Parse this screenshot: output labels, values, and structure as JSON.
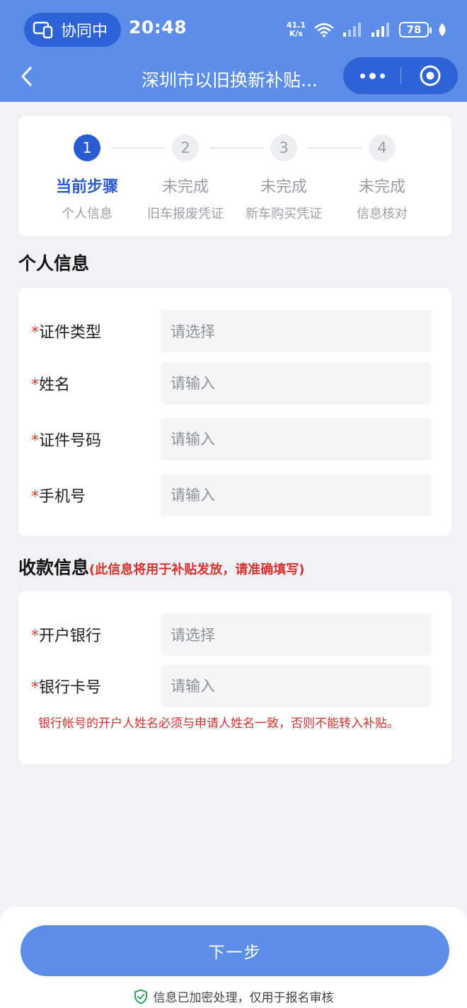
{
  "status_bar": {
    "collab_label": "协同中",
    "time": "20:48",
    "net_speed_value": "41.1",
    "net_speed_unit": "K/s",
    "battery": "78"
  },
  "nav": {
    "title": "深圳市以旧换新补贴..."
  },
  "steps": [
    {
      "number": "1",
      "status": "当前步骤",
      "name": "个人信息",
      "active": true
    },
    {
      "number": "2",
      "status": "未完成",
      "name": "旧车报废凭证",
      "active": false
    },
    {
      "number": "3",
      "status": "未完成",
      "name": "新车购买凭证",
      "active": false
    },
    {
      "number": "4",
      "status": "未完成",
      "name": "信息核对",
      "active": false
    }
  ],
  "personal": {
    "section_title": "个人信息",
    "fields": [
      {
        "required": "*",
        "label": "证件类型",
        "placeholder": "请选择",
        "kind": "select"
      },
      {
        "required": "*",
        "label": "姓名",
        "placeholder": "请输入",
        "kind": "input"
      },
      {
        "required": "*",
        "label": "证件号码",
        "placeholder": "请输入",
        "kind": "input"
      },
      {
        "required": "*",
        "label": "手机号",
        "placeholder": "请输入",
        "kind": "input"
      }
    ]
  },
  "bank": {
    "section_title": "收款信息",
    "section_note": "(此信息将用于补贴发放，请准确填写)",
    "fields": [
      {
        "required": "*",
        "label": "开户银行",
        "placeholder": "请选择",
        "kind": "select"
      },
      {
        "required": "*",
        "label": "银行卡号",
        "placeholder": "请输入",
        "kind": "input"
      }
    ],
    "warning": "银行帐号的开户人姓名必须与申请人姓名一致，否则不能转入补贴。"
  },
  "footer": {
    "next_label": "下一步",
    "secure_note": "信息已加密处理，仅用于报名审核"
  },
  "colors": {
    "brand_blue": "#5c8de8",
    "active_step": "#2b5bd0",
    "required_red": "#e03a32",
    "note_red": "#d6322e"
  },
  "icons": [
    "collab-screen-icon",
    "wifi-icon",
    "signal-icon",
    "battery-icon",
    "leaf-icon",
    "back-arrow-icon",
    "more-dots-icon",
    "close-circle-icon",
    "shield-check-icon"
  ]
}
